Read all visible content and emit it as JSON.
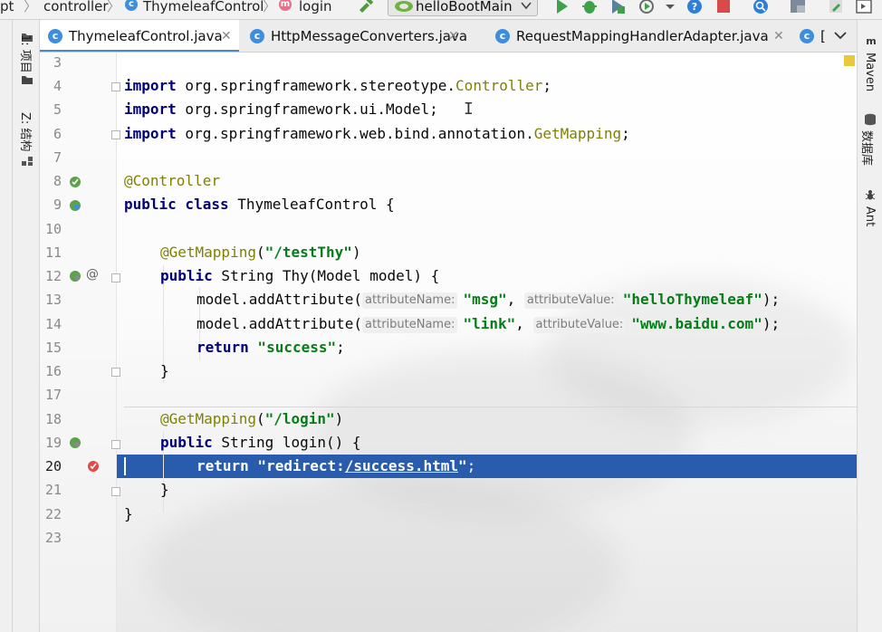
{
  "breadcrumb": {
    "items": [
      "pt",
      "controller",
      "ThymeleafControl",
      "login"
    ],
    "sep": "〉"
  },
  "toolbar": {
    "run_config": "helloBootMain",
    "icons": [
      "build-icon",
      "run-icon",
      "debug-icon",
      "coverage-icon",
      "profile-icon",
      "stop-icon",
      "help-icon",
      "search-icon",
      "structure-icon"
    ]
  },
  "left_panel": {
    "project_label": "1: 项目",
    "structure_label": "Z: 结构"
  },
  "right_panel": {
    "maven_label": "Maven",
    "database_label": "数据库",
    "ant_label": "Ant"
  },
  "tabs": [
    {
      "label": "ThymeleafControl.java",
      "active": true
    },
    {
      "label": "HttpMessageConverters.java",
      "active": false
    },
    {
      "label": "RequestMappingHandlerAdapter.java",
      "active": false
    },
    {
      "label": "[",
      "active": false
    }
  ],
  "editor": {
    "line_numbers": [
      "3",
      "4",
      "5",
      "6",
      "7",
      "8",
      "9",
      "10",
      "11",
      "12",
      "13",
      "14",
      "15",
      "16",
      "17",
      "18",
      "19",
      "20",
      "21",
      "22",
      "23"
    ],
    "current_line": "20",
    "code": {
      "l4_kw": "import",
      "l4_pkg": " org.springframework.stereotype.",
      "l4_cls": "Controller",
      "l4_end": ";",
      "l5_kw": "import",
      "l5_rest": " org.springframework.ui.Model;",
      "l6_kw": "import",
      "l6_pkg": " org.springframework.web.bind.annotation.",
      "l6_cls": "GetMapping",
      "l6_end": ";",
      "l8_ann": "@Controller",
      "l9_kw": "public class",
      "l9_rest": " ThymeleafControl {",
      "l11_ann": "@GetMapping",
      "l11_open": "(",
      "l11_str": "\"/testThy\"",
      "l11_close": ")",
      "l12_kw": "public",
      "l12_rest": " String Thy(Model model) {",
      "l13_call": "model.addAttribute(",
      "l13_hint1": "attributeName:",
      "l13_str1": "\"msg\"",
      "l13_comma": ", ",
      "l13_hint2": "attributeValue:",
      "l13_str2": "\"helloThymeleaf\"",
      "l13_end": ");",
      "l14_call": "model.addAttribute(",
      "l14_hint1": "attributeName:",
      "l14_str1": "\"link\"",
      "l14_comma": ", ",
      "l14_hint2": "attributeValue:",
      "l14_str2": "\"www.baidu.com\"",
      "l14_end": ");",
      "l15_kw": "return",
      "l15_str": " \"success\"",
      "l15_end": ";",
      "l16": "}",
      "l18_ann": "@GetMapping",
      "l18_open": "(",
      "l18_str": "\"/login\"",
      "l18_close": ")",
      "l19_kw": "public",
      "l19_rest": " String login() {",
      "l20_kw": "return",
      "l20_str_a": " \"redirect:",
      "l20_str_b": "/success.html",
      "l20_str_c": "\"",
      "l20_end": ";",
      "l21": "}",
      "l22": "}"
    }
  },
  "colors": {
    "keyword": "#00007a",
    "string": "#067d17",
    "annotation": "#808000",
    "selection": "#2a5cad",
    "tab_accent": "#4a88c7"
  }
}
